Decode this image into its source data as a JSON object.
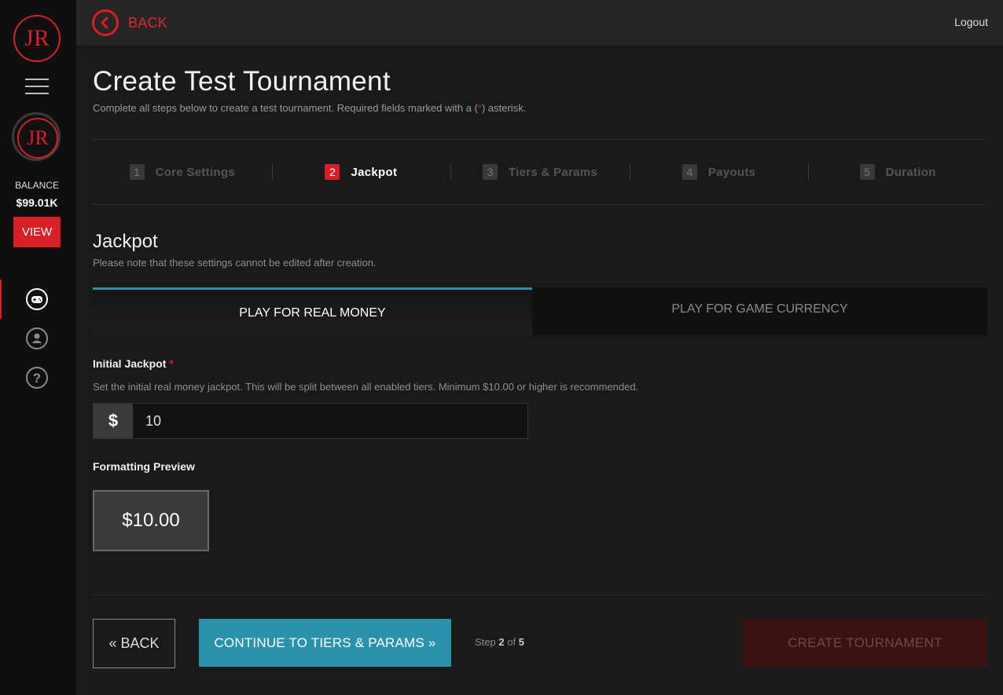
{
  "sidebar": {
    "logo_text": "JR",
    "balance_label": "BALANCE",
    "balance_value": "$99.01K",
    "view_label": "VIEW"
  },
  "topbar": {
    "back_label": "BACK",
    "logout_label": "Logout"
  },
  "page": {
    "title": "Create Test Tournament",
    "subtitle_before": "Complete all steps below to create a test tournament. Required fields marked with a (",
    "subtitle_asterisk": "*",
    "subtitle_after": ") asterisk."
  },
  "steps": [
    {
      "number": "1",
      "label": "Core Settings",
      "active": false
    },
    {
      "number": "2",
      "label": "Jackpot",
      "active": true
    },
    {
      "number": "3",
      "label": "Tiers & Params",
      "active": false
    },
    {
      "number": "4",
      "label": "Payouts",
      "active": false
    },
    {
      "number": "5",
      "label": "Duration",
      "active": false
    }
  ],
  "section": {
    "title": "Jackpot",
    "note": "Please note that these settings cannot be edited after creation."
  },
  "tabs": {
    "real_money": "PLAY FOR REAL MONEY",
    "game_currency": "PLAY FOR GAME CURRENCY"
  },
  "initial_jackpot": {
    "label": "Initial Jackpot",
    "required_mark": "*",
    "help": "Set the initial real money jackpot. This will be split between all enabled tiers. Minimum $10.00 or higher is recommended.",
    "currency_symbol": "$",
    "value": "10"
  },
  "preview": {
    "label": "Formatting Preview",
    "value": "$10.00"
  },
  "footer": {
    "back_label": "« BACK",
    "continue_label": "CONTINUE TO TIERS & PARAMS »",
    "step_word": "Step",
    "step_current": "2",
    "step_of": "of",
    "step_total": "5",
    "create_label": "CREATE TOURNAMENT"
  },
  "colors": {
    "accent_red": "#d81f26",
    "accent_teal": "#2a93ab"
  }
}
